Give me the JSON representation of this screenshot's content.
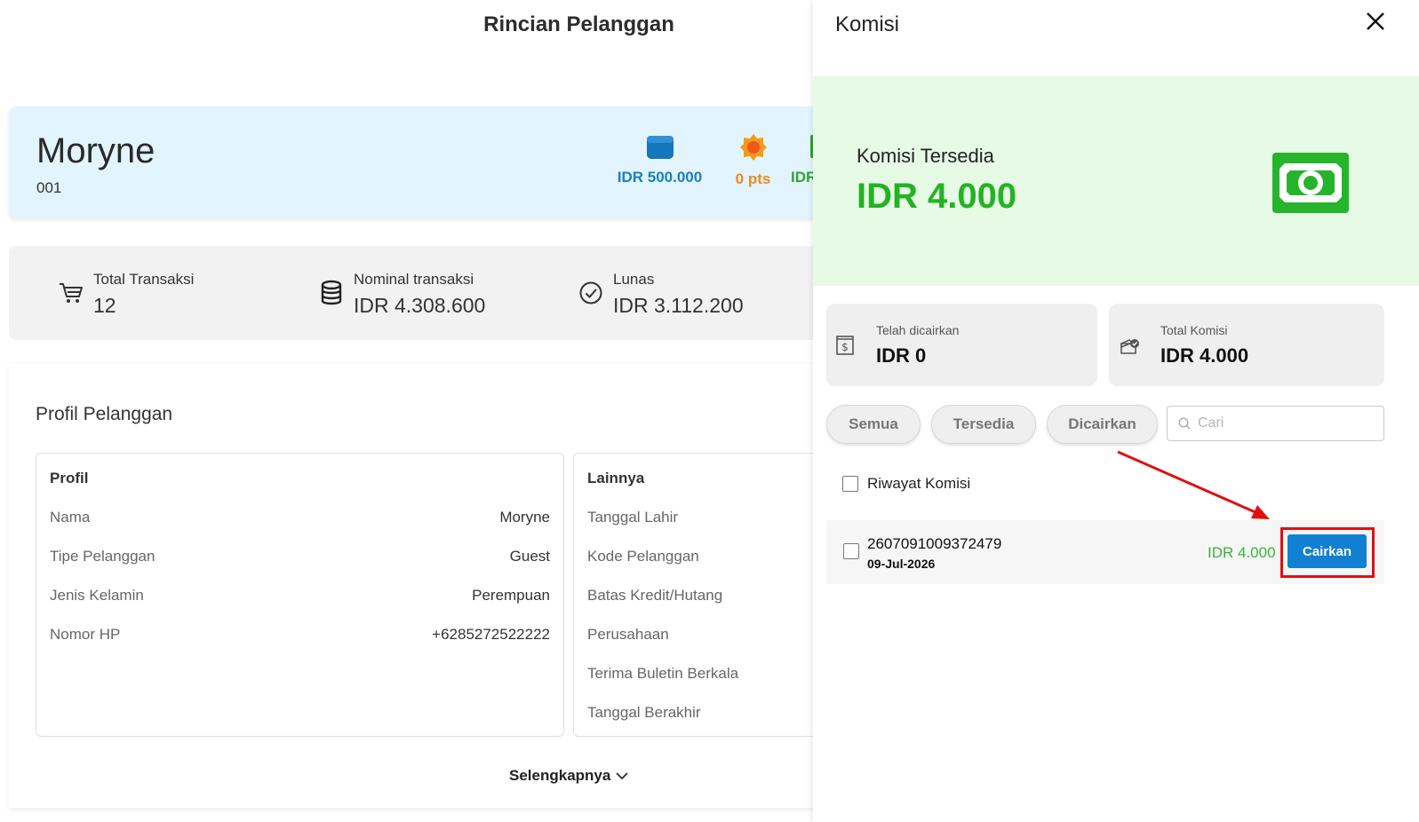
{
  "page": {
    "title": "Rincian Pelanggan"
  },
  "customer": {
    "name": "Moryne",
    "code": "001",
    "deposit": "IDR 500.000",
    "points": "0 pts",
    "third_stat": "IDR"
  },
  "summary": [
    {
      "label": "Total Transaksi",
      "value": "12",
      "icon": "cart-icon"
    },
    {
      "label": "Nominal transaksi",
      "value": "IDR 4.308.600",
      "icon": "database-icon"
    },
    {
      "label": "Lunas",
      "value": "IDR 3.112.200",
      "icon": "check-circle-icon"
    }
  ],
  "profile": {
    "title": "Profil Pelanggan",
    "profil": {
      "heading": "Profil",
      "rows": [
        {
          "label": "Nama",
          "value": "Moryne"
        },
        {
          "label": "Tipe Pelanggan",
          "value": "Guest"
        },
        {
          "label": "Jenis Kelamin",
          "value": "Perempuan"
        },
        {
          "label": "Nomor HP",
          "value": "+6285272522222"
        }
      ]
    },
    "lainnya": {
      "heading": "Lainnya",
      "rows": [
        {
          "label": "Tanggal Lahir"
        },
        {
          "label": "Kode Pelanggan"
        },
        {
          "label": "Batas Kredit/Hutang"
        },
        {
          "label": "Perusahaan"
        },
        {
          "label": "Terima Buletin Berkala"
        },
        {
          "label": "Tanggal Berakhir"
        }
      ]
    },
    "more_label": "Selengkapnya"
  },
  "drawer": {
    "title": "Komisi",
    "available_label": "Komisi Tersedia",
    "available_amount": "IDR 4.000",
    "paid_label": "Telah dicairkan",
    "paid_amount": "IDR 0",
    "total_label": "Total Komisi",
    "total_amount": "IDR 4.000",
    "filters": [
      "Semua",
      "Tersedia",
      "Dicairkan"
    ],
    "search_placeholder": "Cari",
    "history_label": "Riwayat Komisi",
    "records": [
      {
        "id": "2607091009372479",
        "date": "09-Jul-2026",
        "amount": "IDR 4.000",
        "action": "Cairkan"
      }
    ]
  },
  "colors": {
    "accent_blue": "#1280d2",
    "green": "#23b323",
    "annotation_red": "#e01010",
    "card_blue": "#e2f4fd",
    "hero_green": "#e6fae6"
  }
}
